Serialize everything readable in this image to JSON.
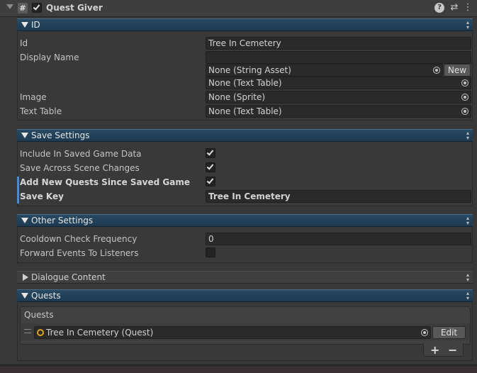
{
  "component": {
    "title": "Quest Giver",
    "script_icon": "#"
  },
  "sections": {
    "id": {
      "title": "ID"
    },
    "save": {
      "title": "Save Settings"
    },
    "other": {
      "title": "Other Settings"
    },
    "dialogue": {
      "title": "Dialogue Content"
    },
    "quests": {
      "title": "Quests"
    }
  },
  "id_fields": {
    "id_label": "Id",
    "id_value": "Tree In Cemetery",
    "display_name_label": "Display Name",
    "display_name_value": "",
    "string_asset_value": "None (String Asset)",
    "new_button": "New",
    "display_text_table_value": "None (Text Table)",
    "image_label": "Image",
    "image_value": "None (Sprite)",
    "text_table_label": "Text Table",
    "text_table_value": "None (Text Table)"
  },
  "save_fields": {
    "include_label": "Include In Saved Game Data",
    "include_checked": true,
    "across_label": "Save Across Scene Changes",
    "across_checked": true,
    "add_new_label": "Add New Quests Since Saved Game",
    "add_new_checked": true,
    "save_key_label": "Save Key",
    "save_key_value": "Tree In Cemetery"
  },
  "other_fields": {
    "cooldown_label": "Cooldown Check Frequency",
    "cooldown_value": "0",
    "forward_label": "Forward Events To Listeners",
    "forward_checked": false
  },
  "quests_list": {
    "header": "Quests",
    "items": [
      {
        "label": "Tree In Cemetery (Quest)",
        "edit_button": "Edit"
      }
    ],
    "add_button": "+",
    "remove_button": "−"
  },
  "icons": {
    "help": "?",
    "preset": "⇄",
    "menu": "⋮",
    "updown": "▲▼"
  }
}
